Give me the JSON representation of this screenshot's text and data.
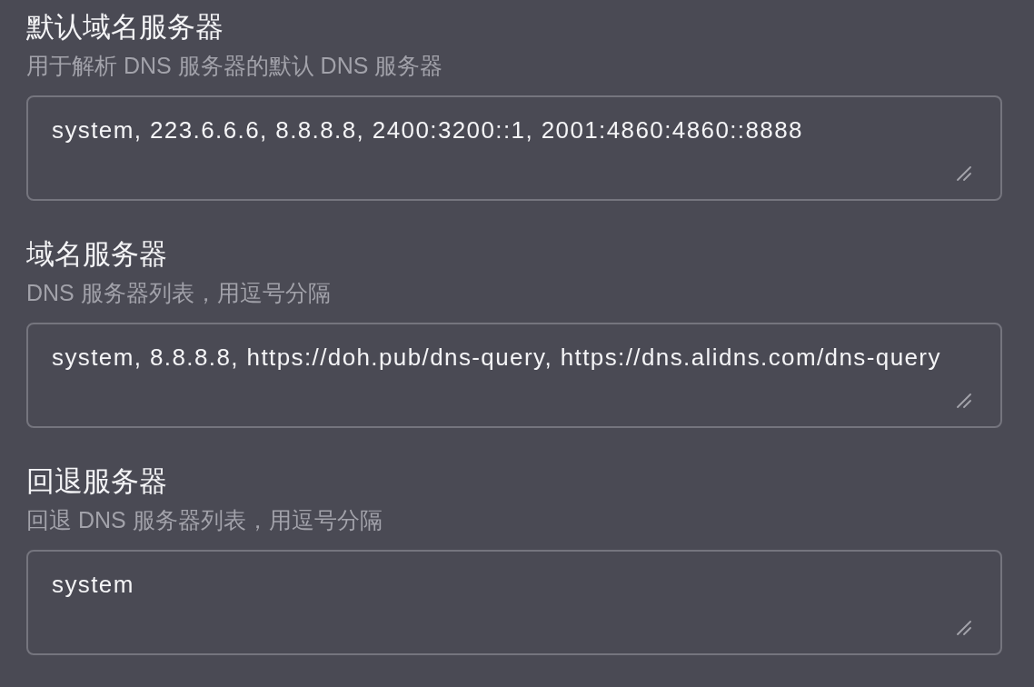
{
  "fields": [
    {
      "label": "默认域名服务器",
      "description": "用于解析 DNS 服务器的默认 DNS 服务器",
      "value": "system, 223.6.6.6, 8.8.8.8, 2400:3200::1, 2001:4860:4860::8888"
    },
    {
      "label": "域名服务器",
      "description": "DNS 服务器列表，用逗号分隔",
      "value": "system, 8.8.8.8, https://doh.pub/dns-query, https://dns.alidns.com/dns-query"
    },
    {
      "label": "回退服务器",
      "description": "回退 DNS 服务器列表，用逗号分隔",
      "value": "system"
    }
  ]
}
